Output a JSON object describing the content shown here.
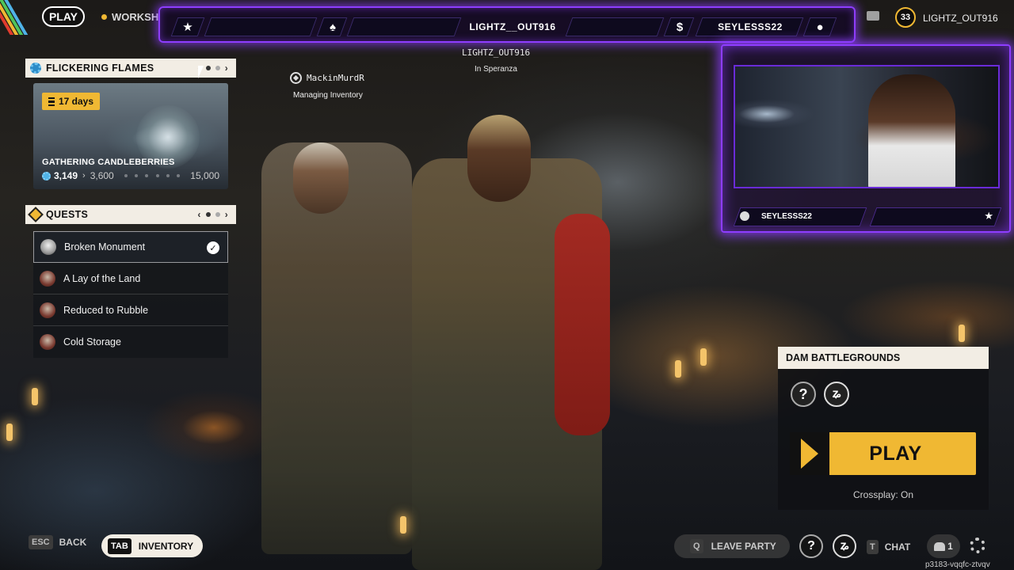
{
  "topbar": {
    "play_label": "PLAY",
    "workshop_label": "WORKSH",
    "stream_center_name": "LIGHTZ__OUT916",
    "stream_right_name": "SEYLESSS22",
    "star_icon": "star-icon",
    "currency_icon": "dollar-icon",
    "level": "33",
    "player_name": "LIGHTZ_OUT916"
  },
  "event": {
    "title": "FLICKERING FLAMES",
    "days_left": "17 days",
    "card_title": "GATHERING CANDLEBERRIES",
    "current": "3,149",
    "next_tier": "3,600",
    "max": "15,000",
    "progress_fraction": 0.21
  },
  "quests": {
    "title": "QUESTS",
    "items": [
      {
        "label": "Broken Monument",
        "completed": true
      },
      {
        "label": "A Lay of the Land",
        "completed": false
      },
      {
        "label": "Reduced to Rubble",
        "completed": false
      },
      {
        "label": "Cold Storage",
        "completed": false
      }
    ]
  },
  "lobby": {
    "center_name": "LIGHTZ_OUT916",
    "center_location": "In Speranza",
    "teammate_name": "MackinMurdR",
    "teammate_status": "Managing Inventory"
  },
  "webcam": {
    "username": "SEYLESSS22"
  },
  "mode": {
    "name": "DAM BATTLEGROUNDS",
    "play_label": "PLAY",
    "crossplay": "Crossplay: On"
  },
  "bottom": {
    "esc_key": "ESC",
    "back_label": "BACK",
    "tab_key": "TAB",
    "inventory_label": "INVENTORY",
    "q_key": "Q",
    "leave_party_label": "LEAVE PARTY",
    "t_key": "T",
    "chat_label": "CHAT",
    "party_count": "1",
    "build_id": "p3183-vqqfc-ztvqv"
  },
  "colors": {
    "accent_yellow": "#f0b833",
    "stream_purple": "#8e3dff",
    "panel_cream": "#f2ede4"
  }
}
